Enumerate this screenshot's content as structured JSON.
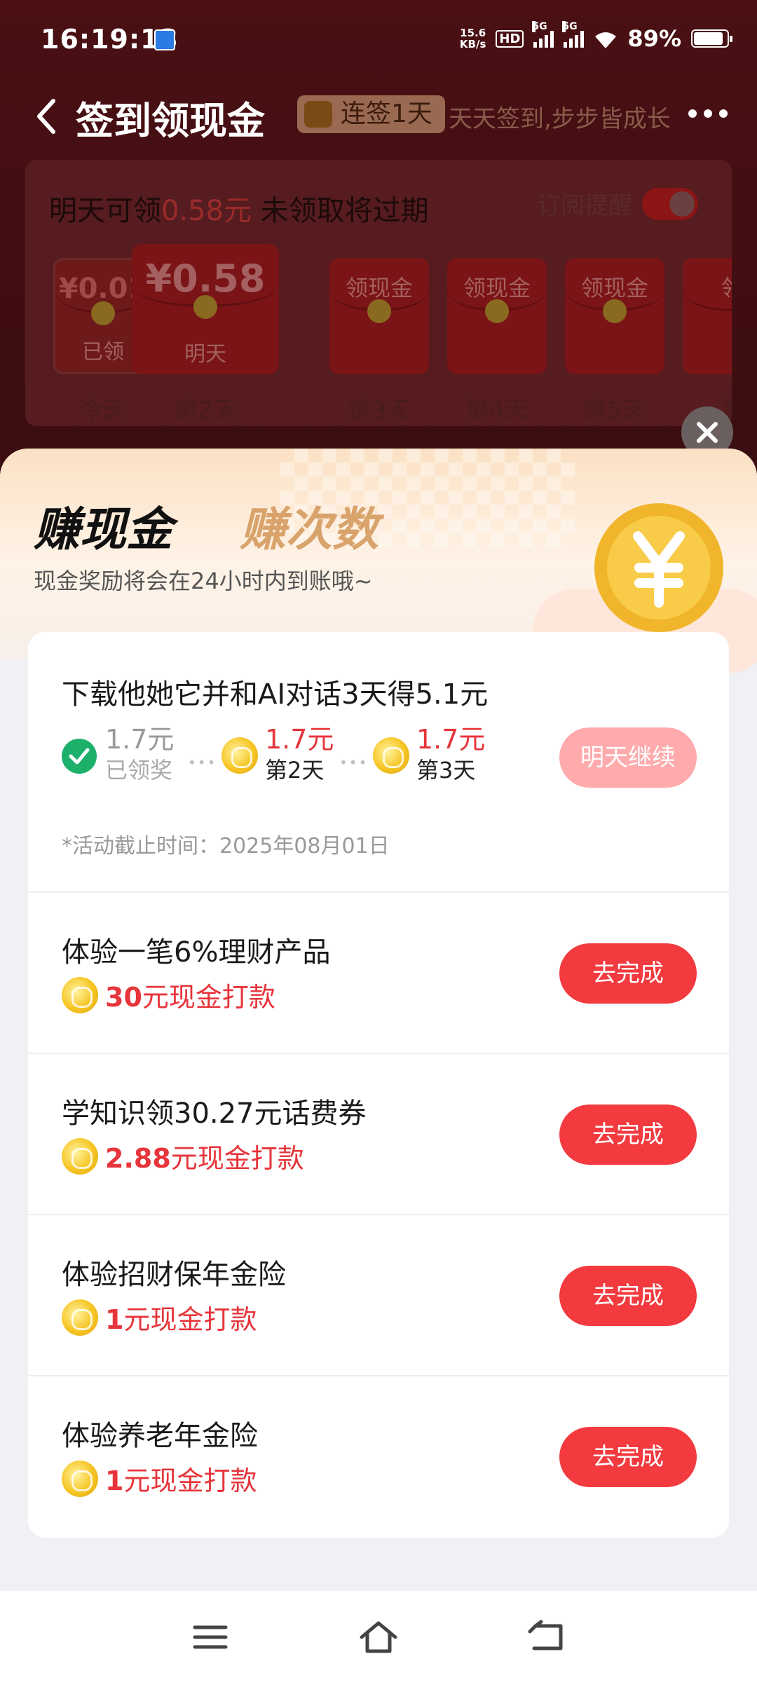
{
  "status_bar": {
    "time": "16:19:13",
    "net_speed_value": "15.6",
    "net_speed_unit": "KB/s",
    "hd": "HD",
    "sig1": "5G",
    "sig2": "5G",
    "battery": "89%"
  },
  "header": {
    "title": "签到领现金",
    "streak_badge": "连签1天",
    "slogan": "天天签到,步步皆成长"
  },
  "checkin": {
    "tomorrow_prefix": "明天可领",
    "tomorrow_amount": "0.58元",
    "tomorrow_suffix": " 未领取将过期",
    "subscribe_label": "订阅提醒",
    "days": [
      {
        "amount": "¥0.01",
        "status": "已领",
        "label": "今天"
      },
      {
        "amount": "¥0.58",
        "status": "明天",
        "label": "第2天"
      },
      {
        "amount": "领现金",
        "status": "",
        "label": "第3天"
      },
      {
        "amount": "领现金",
        "status": "",
        "label": "第4天"
      },
      {
        "amount": "领现金",
        "status": "",
        "label": "第5天"
      },
      {
        "amount": "领",
        "status": "",
        "label": "第"
      }
    ]
  },
  "sheet": {
    "tab_cash": "赚现金",
    "tab_count": "赚次数",
    "subtitle": "现金奖励将会在24小时内到账哦~",
    "tasks": [
      {
        "title": "下载他她它并和AI对话3天得5.1元",
        "steps": [
          {
            "amount": "1.7元",
            "note": "已领奖"
          },
          {
            "amount": "1.7元",
            "note": "第2天"
          },
          {
            "amount": "1.7元",
            "note": "第3天"
          }
        ],
        "deadline": "*活动截止时间：2025年08月01日",
        "button": "明天继续"
      },
      {
        "title": "体验一笔6%理财产品",
        "reward_amount": "30",
        "reward_text": "元现金打款",
        "button": "去完成"
      },
      {
        "title": "学知识领30.27元话费券",
        "reward_amount": "2.88",
        "reward_text": "元现金打款",
        "button": "去完成"
      },
      {
        "title": "体验招财保年金险",
        "reward_amount": "1",
        "reward_text": "元现金打款",
        "button": "去完成"
      },
      {
        "title": "体验养老年金险",
        "reward_amount": "1",
        "reward_text": "元现金打款",
        "button": "去完成"
      }
    ]
  },
  "nav_bar": {
    "items": [
      "menu-icon",
      "home-icon",
      "back-nav-icon"
    ]
  },
  "colors": {
    "accent_red": "#f23a3f",
    "muted_red": "#ffabad",
    "success_green": "#1cb06b",
    "coin_gold": "#f6c523"
  }
}
